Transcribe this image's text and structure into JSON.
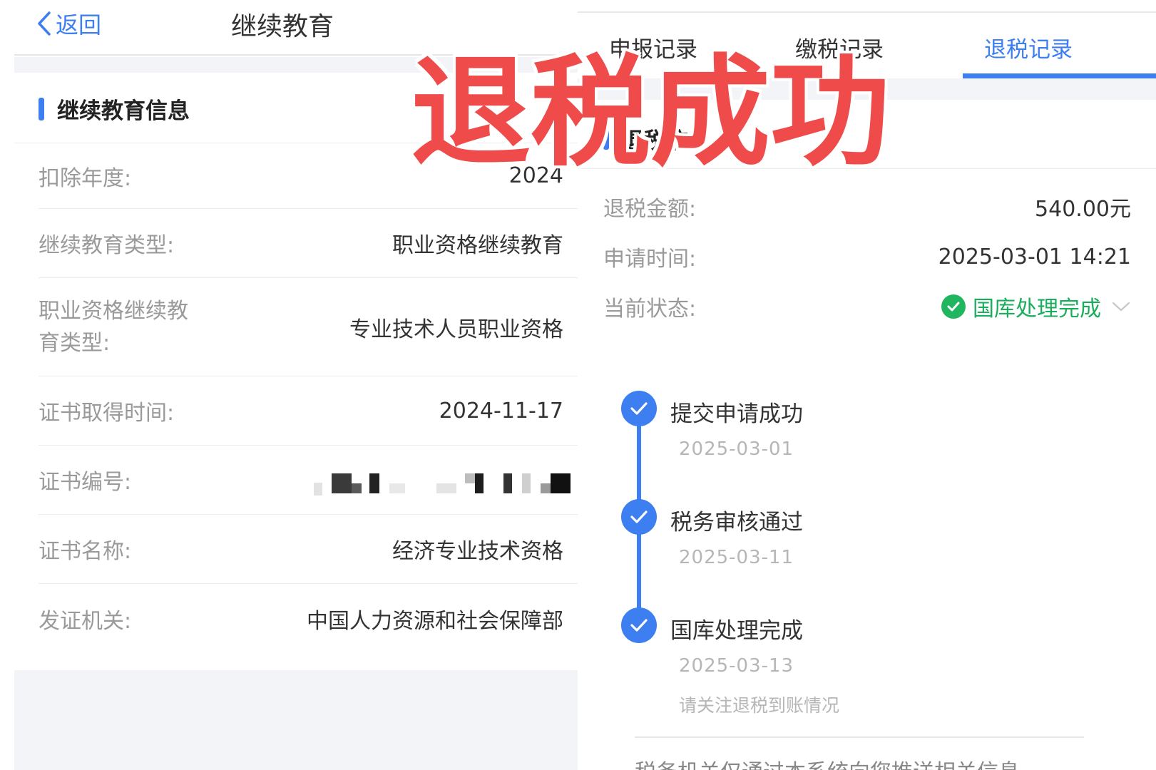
{
  "left": {
    "nav": {
      "back_label": "返回",
      "title": "继续教育"
    },
    "section_title": "继续教育信息",
    "rows": [
      {
        "label": "扣除年度:",
        "value": "2024"
      },
      {
        "label": "继续教育类型:",
        "value": "职业资格继续教育"
      },
      {
        "label_line1": "职业资格继续教",
        "label_line2": "育类型:",
        "value": "专业技术人员职业资格"
      },
      {
        "label": "证书取得时间:",
        "value": "2024-11-17"
      },
      {
        "label": "证书编号:",
        "value": ""
      },
      {
        "label": "证书名称:",
        "value": "经济专业技术资格"
      },
      {
        "label": "发证机关:",
        "value": "中国人力资源和社会保障部"
      }
    ]
  },
  "right": {
    "tabs": [
      {
        "label": "申报记录",
        "active": false
      },
      {
        "label": "缴税记录",
        "active": false
      },
      {
        "label": "退税记录",
        "active": true
      }
    ],
    "section_title": "退税信息",
    "rows": [
      {
        "label": "退税金额:",
        "value": "540.00元"
      },
      {
        "label": "申请时间:",
        "value": "2025-03-01 14:21"
      },
      {
        "label": "当前状态:",
        "value": "国库处理完成"
      }
    ],
    "timeline": [
      {
        "title": "提交申请成功",
        "date": "2025-03-01"
      },
      {
        "title": "税务审核通过",
        "date": "2025-03-11"
      },
      {
        "title": "国库处理完成",
        "date": "2025-03-13"
      }
    ],
    "timeline_note": "请关注退税到账情况",
    "bottom_text": "税务机关仅通过本系统向您推送相关信息"
  },
  "overlay_text": "退税成功",
  "colors": {
    "accent": "#3d7ef0",
    "success": "#1aad5b",
    "overlay": "#ef4b4b"
  }
}
